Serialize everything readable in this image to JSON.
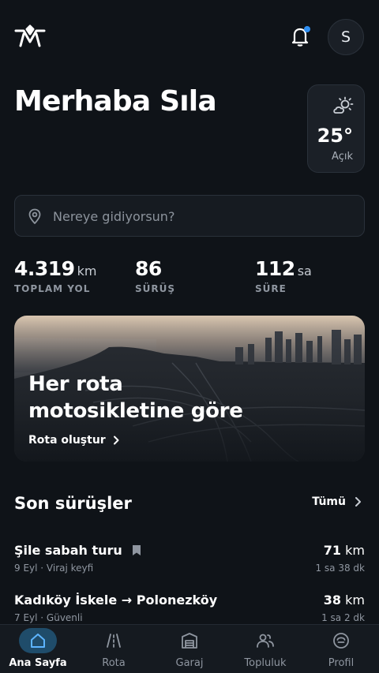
{
  "header": {
    "logo_icon": "motorcycle-brand-logo",
    "notification_icon": "bell-icon",
    "has_notification": true,
    "avatar_initial": "S"
  },
  "greeting": "Merhaba Sıla",
  "weather": {
    "icon": "partly-cloudy-sun-icon",
    "temperature": "25°",
    "condition": "Açık"
  },
  "search": {
    "placeholder": "Nereye gidiyorsun?",
    "value": ""
  },
  "stats": [
    {
      "value": "4.319",
      "unit": "km",
      "label": "TOPLAM YOL"
    },
    {
      "value": "86",
      "unit": "",
      "label": "SÜRÜŞ"
    },
    {
      "value": "112",
      "unit": "sa",
      "label": "SÜRE"
    }
  ],
  "hero": {
    "title": "Her rota motosikletine göre",
    "cta": "Rota oluştur"
  },
  "recent": {
    "title": "Son sürüşler",
    "see_all": "Tümü",
    "rides": [
      {
        "name": "Şile sabah turu",
        "bookmarked": true,
        "meta": "9 Eyl · Viraj keyfi",
        "distance": "71",
        "unit": "km",
        "duration": "1 sa 38 dk"
      },
      {
        "name": "Kadıköy İskele → Polonezköy",
        "bookmarked": false,
        "meta": "7 Eyl · Güvenli",
        "distance": "38",
        "unit": "km",
        "duration": "1 sa 2 dk"
      }
    ]
  },
  "nav": {
    "active": "Ana Sayfa",
    "items": [
      {
        "label": "Ana Sayfa",
        "icon": "home-icon"
      },
      {
        "label": "Rota",
        "icon": "road-icon"
      },
      {
        "label": "Garaj",
        "icon": "garage-icon"
      },
      {
        "label": "Topluluk",
        "icon": "community-icon"
      },
      {
        "label": "Profil",
        "icon": "profile-icon"
      }
    ]
  },
  "colors": {
    "background": "#0f1318",
    "accent": "#2f8ff2",
    "active_tab_bg": "#1f4c6a",
    "muted_text": "#8f96a0"
  }
}
